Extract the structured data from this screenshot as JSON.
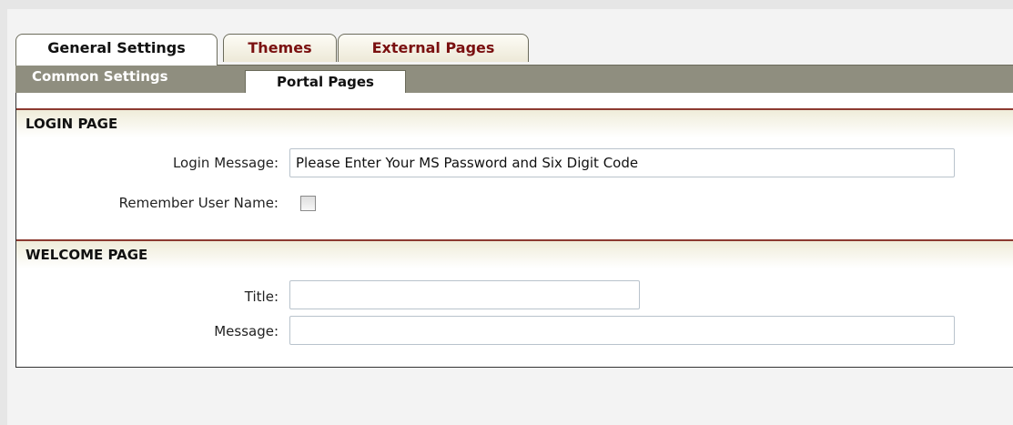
{
  "tabs": {
    "general": "General Settings",
    "themes": "Themes",
    "external": "External Pages"
  },
  "subtabs": {
    "common": "Common Settings",
    "portal": "Portal Pages"
  },
  "login_page": {
    "title": "LOGIN PAGE",
    "message_label": "Login Message:",
    "message_value": "Please Enter Your MS Password and Six Digit Code",
    "remember_label": "Remember User Name:",
    "remember_checked": false
  },
  "welcome_page": {
    "title": "WELCOME PAGE",
    "title_label": "Title:",
    "title_value": "",
    "message_label": "Message:",
    "message_value": ""
  },
  "colors": {
    "accent_tab_text": "#7a1010",
    "subbar_bg": "#8f8e7f",
    "section_rule": "#8c3a30"
  }
}
